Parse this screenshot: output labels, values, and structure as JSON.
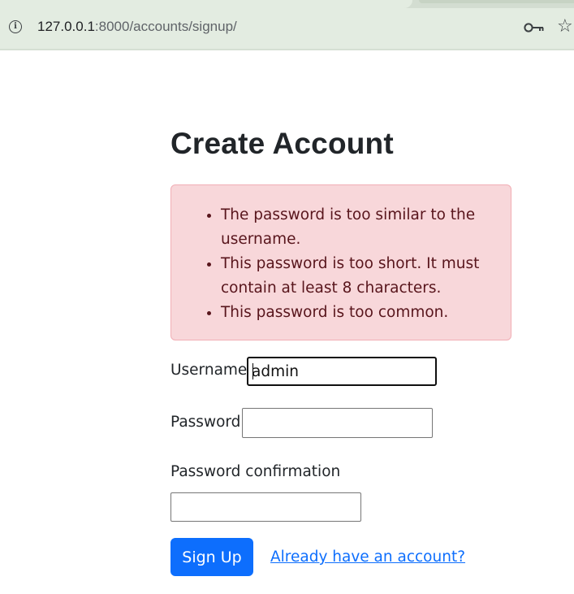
{
  "browser": {
    "url_host": "127.0.0.1",
    "url_path": ":8000/accounts/signup/",
    "info_icon": "info-icon",
    "key_icon": "key-icon",
    "star_icon": "star-icon",
    "star_glyph": "☆",
    "info_glyph": "i"
  },
  "page": {
    "title": "Create Account",
    "errors": [
      "The password is too similar to the username.",
      "This password is too short. It must contain at least 8 characters.",
      "This password is too common."
    ],
    "colors": {
      "alert_background": "#f8d7da",
      "alert_text": "#58151c",
      "primary": "#0d6efd"
    }
  },
  "form": {
    "username_label": "Username",
    "username_value": "admin",
    "password_label": "Password",
    "password_value": "",
    "password_confirmation_label": "Password confirmation",
    "password_confirmation_value": "",
    "submit_label": "Sign Up",
    "login_link": "Already have an account?"
  }
}
